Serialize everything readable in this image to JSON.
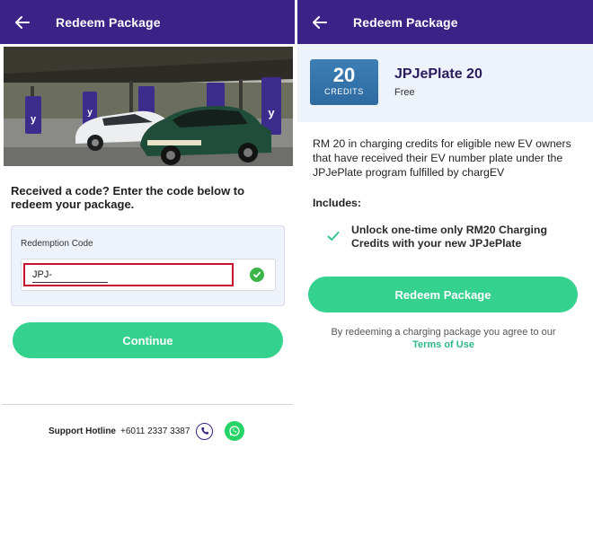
{
  "left_screen": {
    "header": {
      "title": "Redeem Package",
      "back_icon": "arrow-left-icon"
    },
    "prompt": "Received a code? Enter the code below to redeem your package.",
    "code_card": {
      "label": "Redemption Code",
      "input_value": "JPJ-",
      "status_icon": "check-circle-icon"
    },
    "continue_label": "Continue",
    "support": {
      "label": "Support Hotline",
      "number": "+6011 2337 3387",
      "phone_icon": "phone-icon",
      "whatsapp_icon": "whatsapp-icon"
    }
  },
  "right_screen": {
    "header": {
      "title": "Redeem Package",
      "back_icon": "arrow-left-icon"
    },
    "package": {
      "credits": "20",
      "credits_unit": "CREDITS",
      "name": "JPJePlate 20",
      "price": "Free"
    },
    "description": "RM 20 in charging credits for eligible new EV owners that have received their EV number plate under the JPJePlate program fulfilled by chargEV",
    "includes_title": "Includes:",
    "includes": [
      "Unlock one-time only RM20 Charging Credits with your new JPJePlate"
    ],
    "redeem_label": "Redeem Package",
    "terms_text": "By redeeming a charging package you agree to our",
    "terms_link": "Terms of Use"
  },
  "colors": {
    "header_bg": "#3a2287",
    "button_green": "#34d28e",
    "link_green": "#2fb98a",
    "error_border": "#c8102e",
    "credit_tile": "#2d6aa1"
  }
}
